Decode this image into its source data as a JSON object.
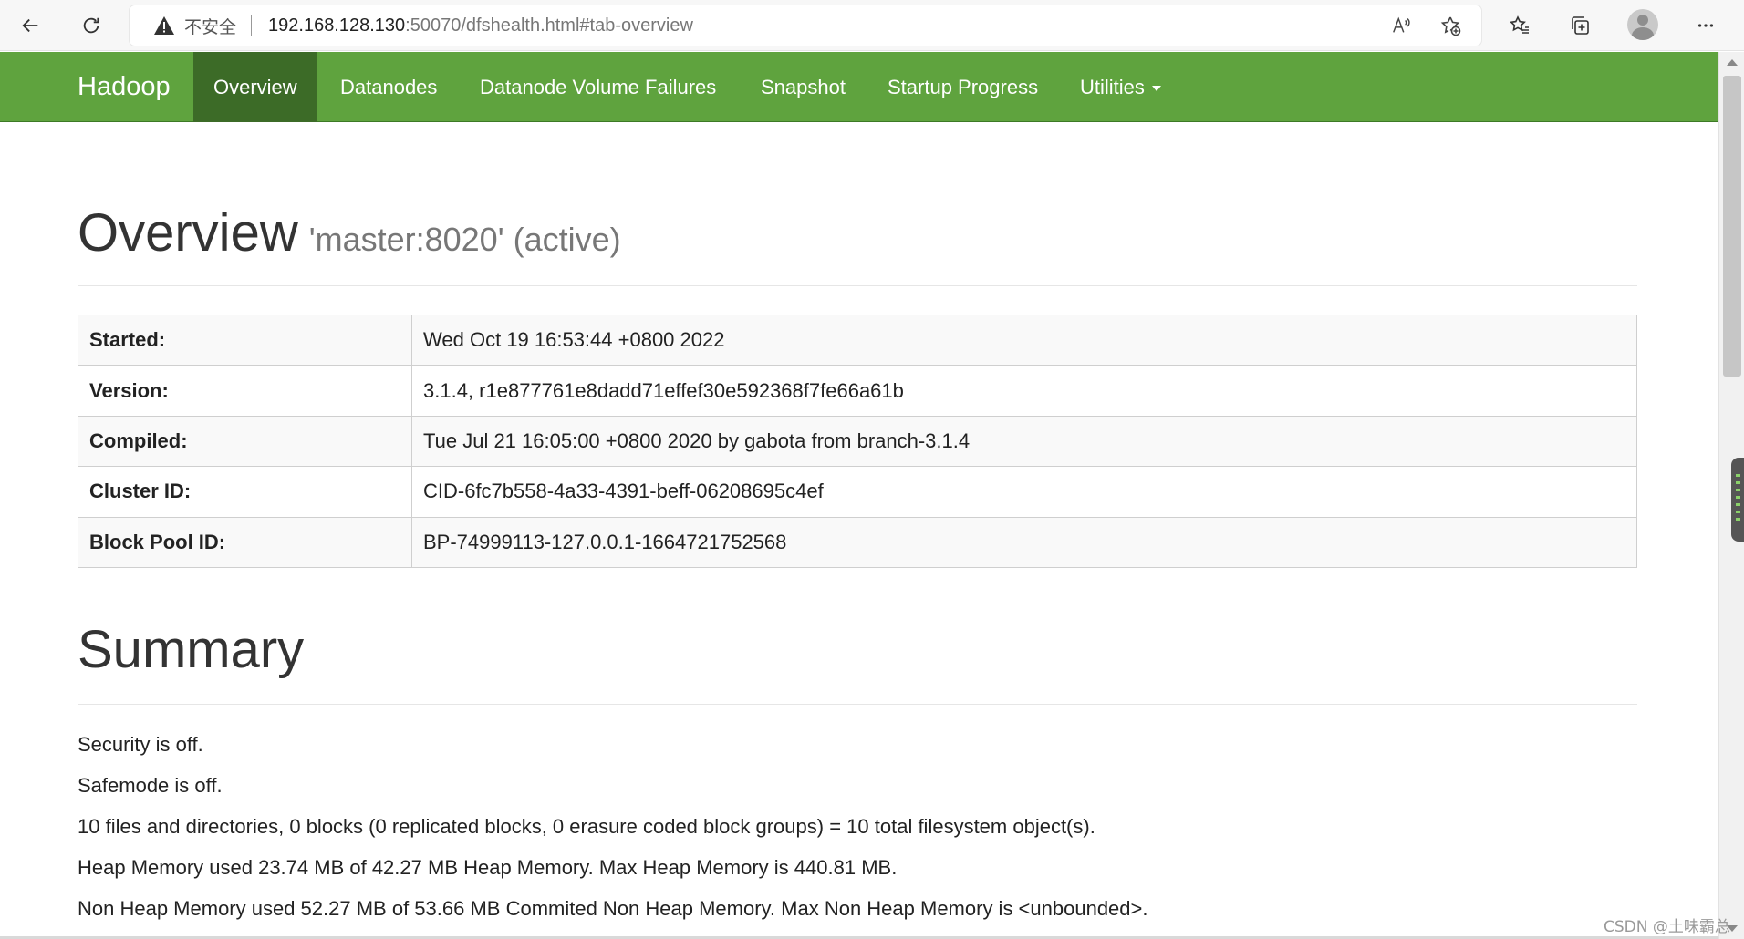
{
  "browser": {
    "insecure_label": "不安全",
    "url_host": "192.168.128.130",
    "url_rest": ":50070/dfshealth.html#tab-overview"
  },
  "navbar": {
    "brand": "Hadoop",
    "items": [
      {
        "label": "Overview"
      },
      {
        "label": "Datanodes"
      },
      {
        "label": "Datanode Volume Failures"
      },
      {
        "label": "Snapshot"
      },
      {
        "label": "Startup Progress"
      },
      {
        "label": "Utilities"
      }
    ],
    "colors": {
      "background": "#5fa33e",
      "active": "#3c6b27"
    }
  },
  "overview": {
    "title": "Overview",
    "subtitle": "'master:8020' (active)",
    "rows": [
      {
        "key": "Started:",
        "value": "Wed Oct 19 16:53:44 +0800 2022"
      },
      {
        "key": "Version:",
        "value": "3.1.4, r1e877761e8dadd71effef30e592368f7fe66a61b"
      },
      {
        "key": "Compiled:",
        "value": "Tue Jul 21 16:05:00 +0800 2020 by gabota from branch-3.1.4"
      },
      {
        "key": "Cluster ID:",
        "value": "CID-6fc7b558-4a33-4391-beff-06208695c4ef"
      },
      {
        "key": "Block Pool ID:",
        "value": "BP-74999113-127.0.0.1-1664721752568"
      }
    ]
  },
  "summary": {
    "title": "Summary",
    "lines": [
      "Security is off.",
      "Safemode is off.",
      "10 files and directories, 0 blocks (0 replicated blocks, 0 erasure coded block groups) = 10 total filesystem object(s).",
      "Heap Memory used 23.74 MB of 42.27 MB Heap Memory. Max Heap Memory is 440.81 MB.",
      "Non Heap Memory used 52.27 MB of 53.66 MB Commited Non Heap Memory. Max Non Heap Memory is <unbounded>."
    ]
  },
  "watermark": "CSDN @土味霸总"
}
